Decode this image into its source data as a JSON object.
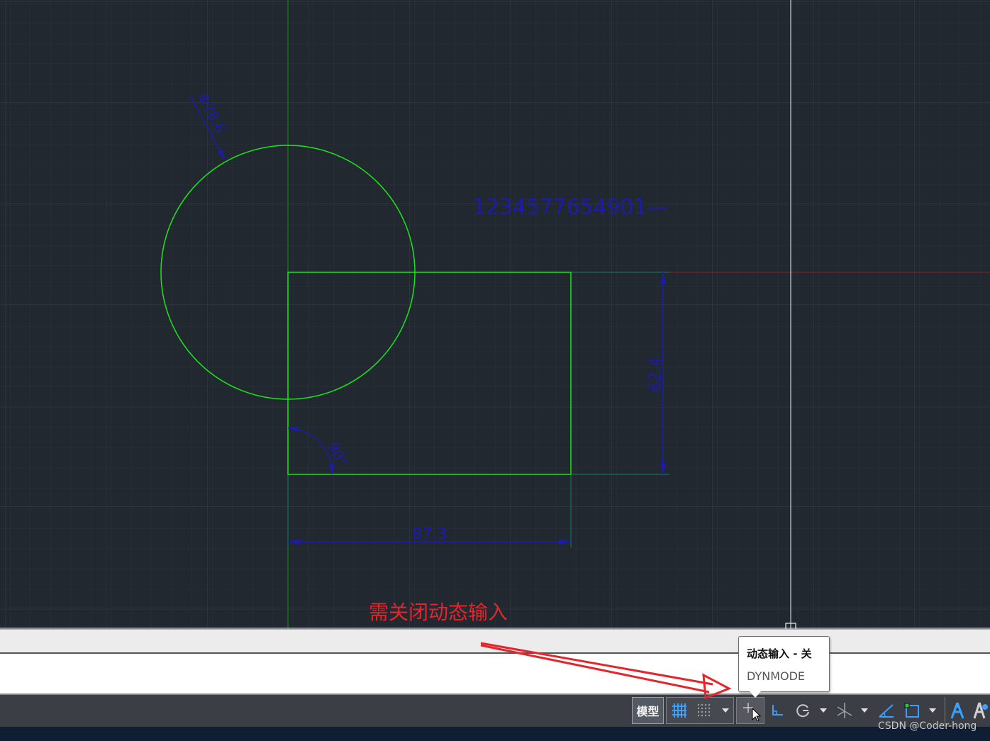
{
  "drawing": {
    "circle_diameter_label": "Φ78.6",
    "text_entity": "1234577654901—",
    "height_dimension": "62.4",
    "width_dimension": "87.3",
    "angle_dimension": "90°"
  },
  "annotation": {
    "note": "需关闭动态输入"
  },
  "tooltip": {
    "title": "动态输入 - 关",
    "command": "DYNMODE"
  },
  "status_bar": {
    "model_tab": "模型",
    "icons": [
      "grid-icon",
      "snap-icon",
      "dropdown-icon",
      "dynamic-input-icon",
      "ortho-icon",
      "polar-icon",
      "dropdown-icon",
      "isodraft-icon",
      "dropdown-icon",
      "object-snap-tracking-icon",
      "object-snap-icon",
      "dropdown-icon",
      "annotation-scale-icon",
      "annotation-visibility-icon"
    ]
  },
  "watermark": "CSDN @Coder-hong",
  "colors": {
    "canvas_bg": "#212830",
    "geometry": "#19e619",
    "dimension": "#1c1ca8",
    "annotation": "#e3262b",
    "crosshair": "#ffffff"
  }
}
